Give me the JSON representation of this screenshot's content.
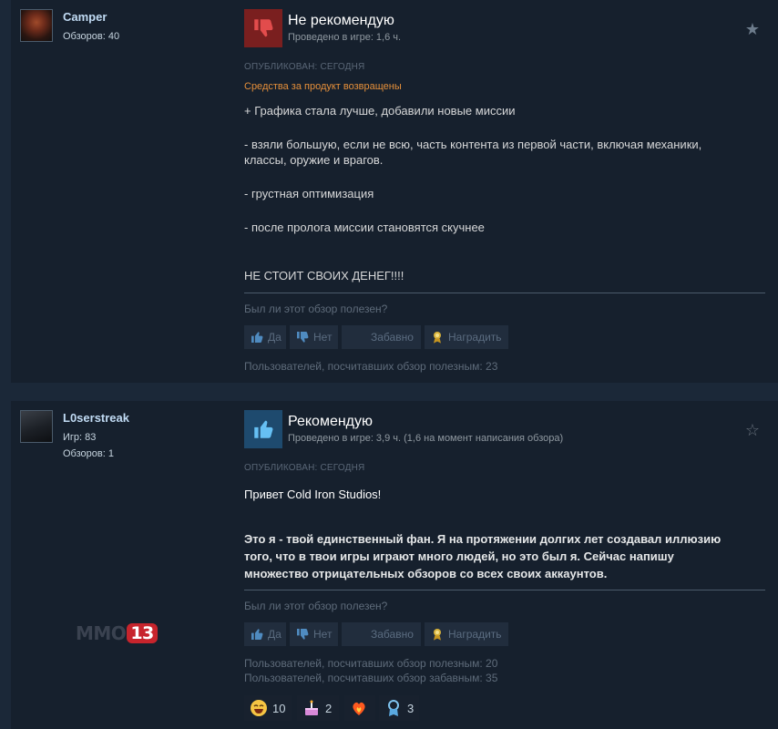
{
  "reviews": [
    {
      "user": {
        "name": "Camper",
        "reviews": "Обзоров: 40"
      },
      "verdict": "Не рекомендую",
      "hours": "Проведено в игре: 1,6 ч.",
      "posted": "ОПУБЛИКОВАН: СЕГОДНЯ",
      "refunded": "Средства за продукт возвращены",
      "body": [
        "+ Графика стала лучше, добавили новые миссии",
        "- взяли большую, если не всю, часть контента из первой части, включая механики,",
        "классы, оружие и врагов.",
        "- грустная оптимизация",
        "- после пролога миссии становятся скучнее",
        "НЕ СТОИТ СВОИХ ДЕНЕГ!!!!"
      ],
      "helpful_question": "Был ли этот обзор полезен?",
      "buttons": {
        "yes": "Да",
        "no": "Нет",
        "funny": "Забавно",
        "award": "Наградить"
      },
      "stats": [
        "Пользователей, посчитавших обзор полезным: 23"
      ]
    },
    {
      "user": {
        "name": "L0serstreak",
        "games": "Игр: 83",
        "reviews": "Обзоров: 1"
      },
      "verdict": "Рекомендую",
      "hours": "Проведено в игре: 3,9 ч. (1,6 на момент написания обзора)",
      "posted": "ОПУБЛИКОВАН: СЕГОДНЯ",
      "body": [
        "Привет Cold Iron Studios!",
        "Это я - твой единственный фан. Я на протяжении долгих лет создавал иллюзию",
        "того, что в твои игры играют много людей, но это был я. Сейчас напишу",
        "множество отрицательных обзоров со всех своих аккаунтов."
      ],
      "helpful_question": "Был ли этот обзор полезен?",
      "buttons": {
        "yes": "Да",
        "no": "Нет",
        "funny": "Забавно",
        "award": "Наградить"
      },
      "stats": [
        "Пользователей, посчитавших обзор полезным: 20",
        "Пользователей, посчитавших обзор забавным: 35"
      ],
      "awards": [
        {
          "icon": "laughing-emoji-icon",
          "count": "10"
        },
        {
          "icon": "cake-icon",
          "count": "2"
        },
        {
          "icon": "fire-heart-icon",
          "count": ""
        },
        {
          "icon": "medal-icon",
          "count": "3"
        }
      ]
    }
  ],
  "watermark": {
    "text": "MMO",
    "number": "13"
  },
  "colors": {
    "page_bg": "#1b2838",
    "card_bg": "#16202d",
    "thumb_down": "#7a1f1f",
    "thumb_up": "#1e4a6e",
    "refund_text": "#e58f3a",
    "user_name": "#c1dbf4"
  }
}
